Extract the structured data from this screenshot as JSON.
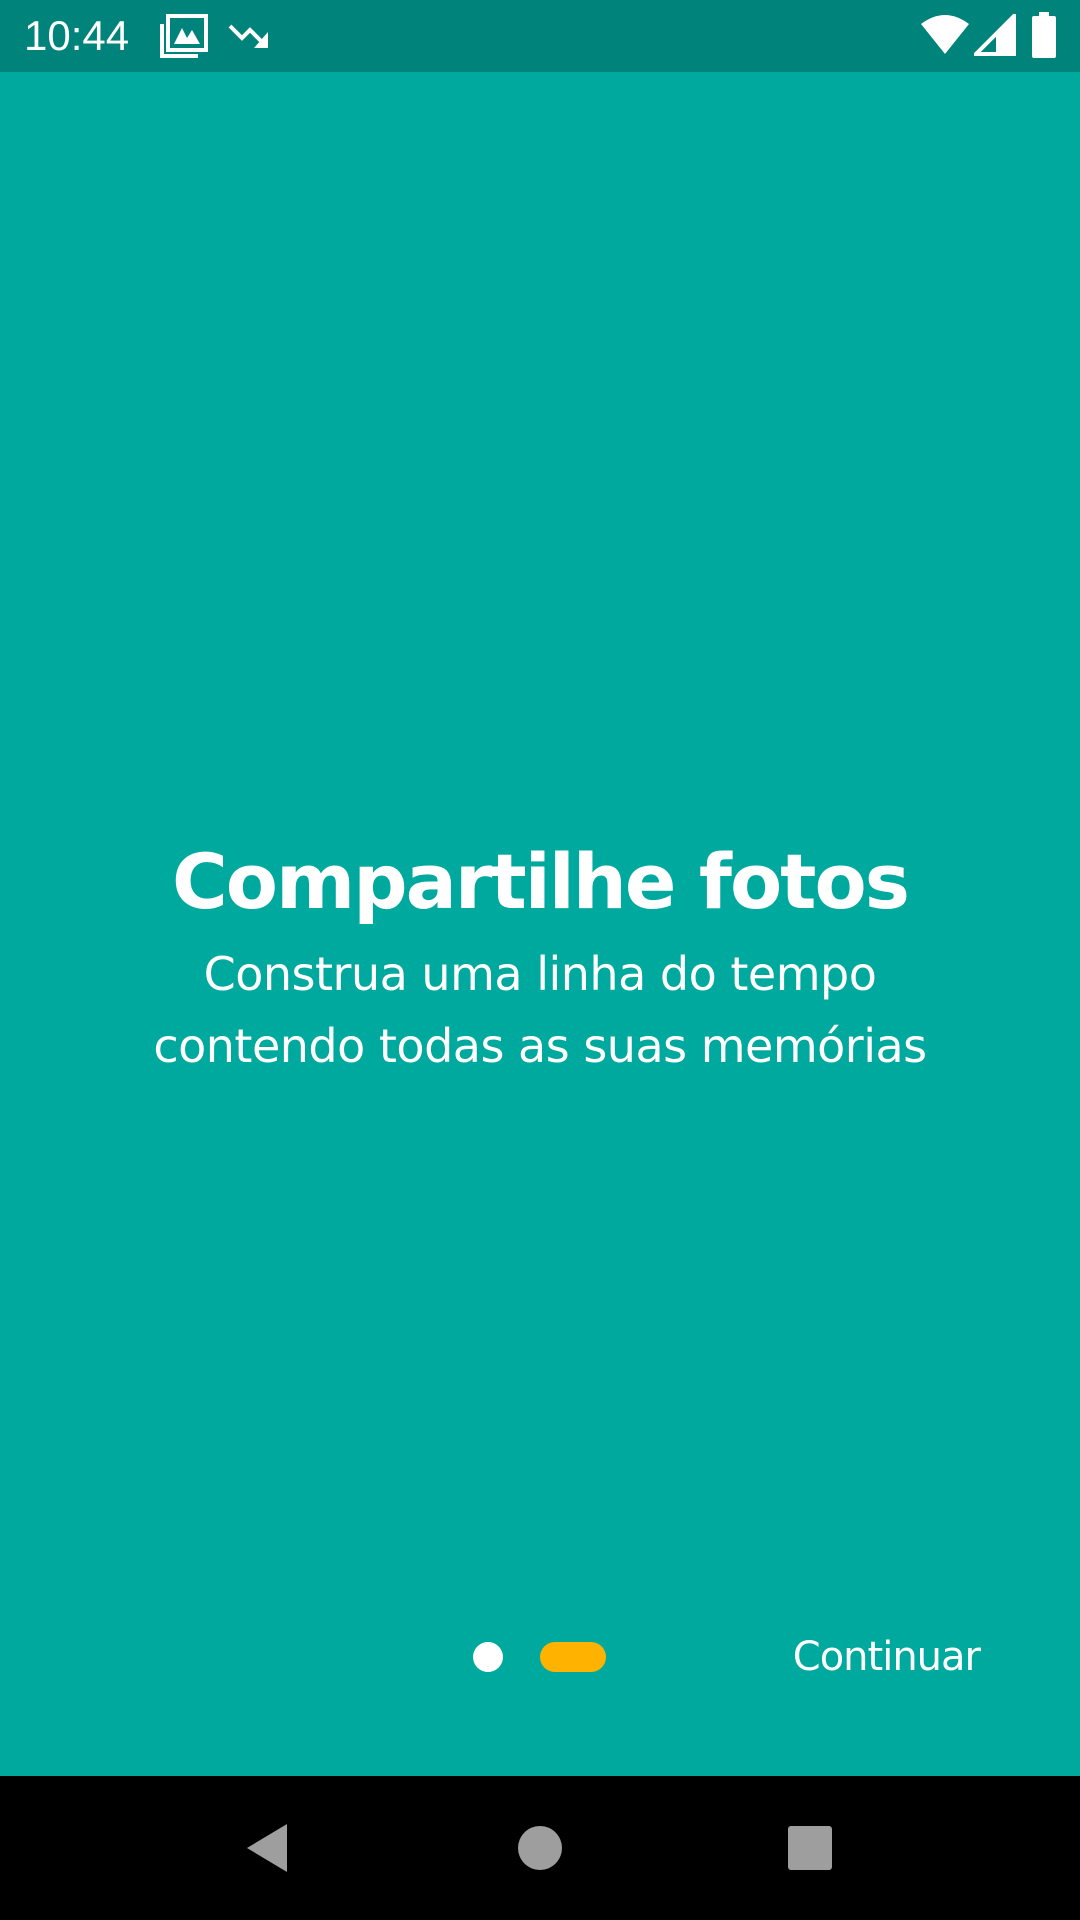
{
  "status_bar": {
    "time": "10:44",
    "icons": [
      "gallery-icon",
      "trend-down-icon",
      "wifi-icon",
      "signal-icon",
      "battery-icon"
    ]
  },
  "onboarding": {
    "title": "Compartilhe fotos",
    "subtitle": "Construa uma linha do tempo contendo todas as suas memórias",
    "page_indicator": {
      "pages": 2,
      "current": 2
    },
    "continue_label": "Continuar"
  },
  "nav_bar": {
    "buttons": [
      "back-icon",
      "home-icon",
      "recents-icon"
    ]
  },
  "colors": {
    "status_bar": "#00837A",
    "background": "#00A99D",
    "accent": "#FFB300",
    "text": "#FFFFFF",
    "nav_bar": "#000000"
  }
}
